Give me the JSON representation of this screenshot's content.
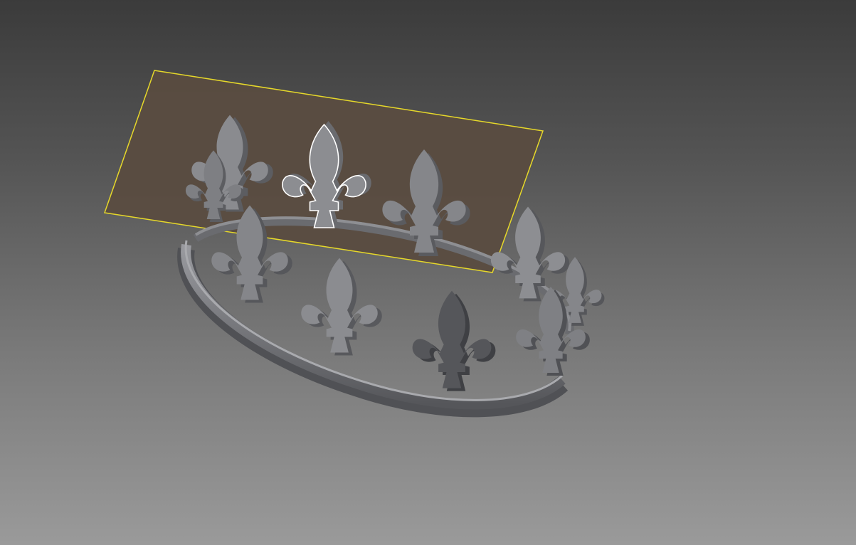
{
  "viewport": {
    "title": "",
    "background_top": "#3b3b3b",
    "background_bottom": "#9a9a9a"
  },
  "model": {
    "name": "",
    "part_color": "#7d7e82",
    "part_dark": "#4e4f53",
    "part_light": "#a6a7ab",
    "selected_face_color": "#8c8d91",
    "selected_edge_color": "#ffffff"
  },
  "work_plane": {
    "fill": "#5a4c40",
    "edge": "#e6d82a"
  }
}
